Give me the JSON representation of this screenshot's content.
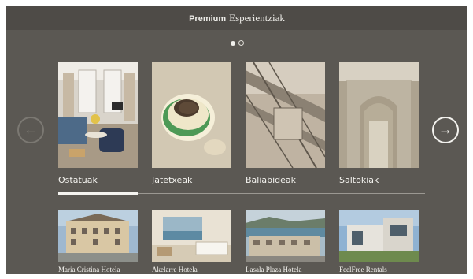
{
  "header": {
    "brand": "Premium",
    "title": "Esperientziak"
  },
  "pagination": {
    "current": 1,
    "total": 2
  },
  "nav": {
    "prev_icon": "arrow-left-icon",
    "next_icon": "arrow-right-icon"
  },
  "categories": [
    {
      "label": "Ostatuak",
      "selected": true
    },
    {
      "label": "Jatetxeak",
      "selected": false
    },
    {
      "label": "Baliabideak",
      "selected": false
    },
    {
      "label": "Saltokiak",
      "selected": false
    }
  ],
  "hotels": [
    {
      "name": "Maria Cristina Hotela"
    },
    {
      "name": "Akelarre Hotela"
    },
    {
      "name": "Lasala Plaza Hotela"
    },
    {
      "name": "FeelFree Rentals"
    }
  ],
  "colors": {
    "background": "#5b5853",
    "header": "#4e4b47",
    "text": "#f5f4f0"
  }
}
